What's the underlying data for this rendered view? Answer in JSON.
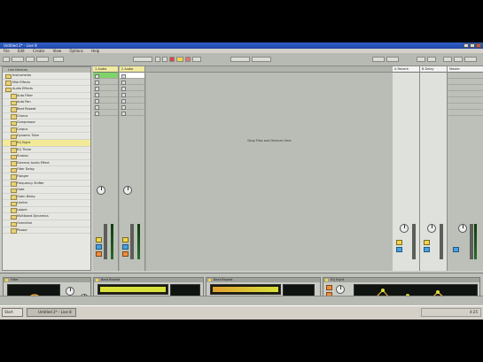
{
  "window": {
    "title": "Untitled 2* - Live 8"
  },
  "menu": [
    "File",
    "Edit",
    "Create",
    "View",
    "Options",
    "Help"
  ],
  "browser": {
    "header": "Live Devices",
    "items": [
      {
        "label": "Instruments",
        "sub": false
      },
      {
        "label": "Midi Effects",
        "sub": false
      },
      {
        "label": "Audio Effects",
        "sub": false
      },
      {
        "label": "Auto Filter",
        "sub": true
      },
      {
        "label": "Auto Pan",
        "sub": true
      },
      {
        "label": "Beat Repeat",
        "sub": true
      },
      {
        "label": "Chorus",
        "sub": true
      },
      {
        "label": "Compressor",
        "sub": true
      },
      {
        "label": "Corpus",
        "sub": true
      },
      {
        "label": "Dynamic Tube",
        "sub": true
      },
      {
        "label": "EQ Eight",
        "sub": true,
        "selected": true
      },
      {
        "label": "EQ Three",
        "sub": true
      },
      {
        "label": "Erosion",
        "sub": true
      },
      {
        "label": "External Audio Effect",
        "sub": true
      },
      {
        "label": "Filter Delay",
        "sub": true
      },
      {
        "label": "Flanger",
        "sub": true
      },
      {
        "label": "Frequency Shifter",
        "sub": true
      },
      {
        "label": "Gate",
        "sub": true
      },
      {
        "label": "Grain Delay",
        "sub": true
      },
      {
        "label": "Limiter",
        "sub": true
      },
      {
        "label": "Looper",
        "sub": true
      },
      {
        "label": "Multiband Dynamics",
        "sub": true
      },
      {
        "label": "Overdrive",
        "sub": true
      },
      {
        "label": "Phaser",
        "sub": true
      }
    ]
  },
  "session": {
    "tracks": [
      "1 Audio",
      "2 Audio"
    ],
    "drop_text": "Drop Files and Devices Here",
    "returns": [
      "A Reverb",
      "B Delay"
    ],
    "master": "Master",
    "audio_to": "Master"
  },
  "devices": [
    {
      "title": "Filter"
    },
    {
      "title": "Beat Repeat"
    },
    {
      "title": "Beat Repeat"
    },
    {
      "title": "EQ Eight"
    }
  ],
  "taskbar": {
    "start": "Start",
    "item": "Untitled 2* - Live 8",
    "clock": "4:25"
  }
}
